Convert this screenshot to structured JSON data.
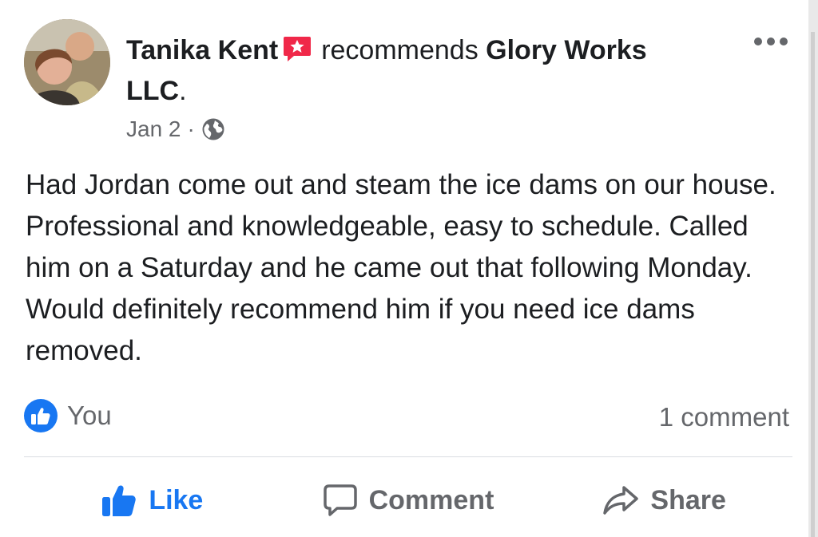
{
  "post": {
    "author": "Tanika Kent",
    "verb": "recommends",
    "page": "Glory Works LLC",
    "page_suffix": ".",
    "date": "Jan 2",
    "separator": "·",
    "body": "Had Jordan come out and steam the ice dams on our house. Professional and knowledgeable, easy to schedule. Called him on a Saturday and he came out that following Monday. Would definitely recommend him if you need ice dams removed."
  },
  "reactions": {
    "who": "You",
    "comments": "1 comment"
  },
  "actions": {
    "like": "Like",
    "comment": "Comment",
    "share": "Share"
  },
  "icons": {
    "recommend": "recommend-star-icon",
    "audience": "globe-icon",
    "menu": "more-options-icon",
    "like_badge": "thumbs-up-icon",
    "like": "thumbs-up-icon",
    "comment": "speech-bubble-icon",
    "share": "share-arrow-icon"
  },
  "colors": {
    "accent": "#1877f2",
    "recommend_red": "#f02849",
    "secondary_text": "#65676b",
    "primary_text": "#1c1e21"
  }
}
